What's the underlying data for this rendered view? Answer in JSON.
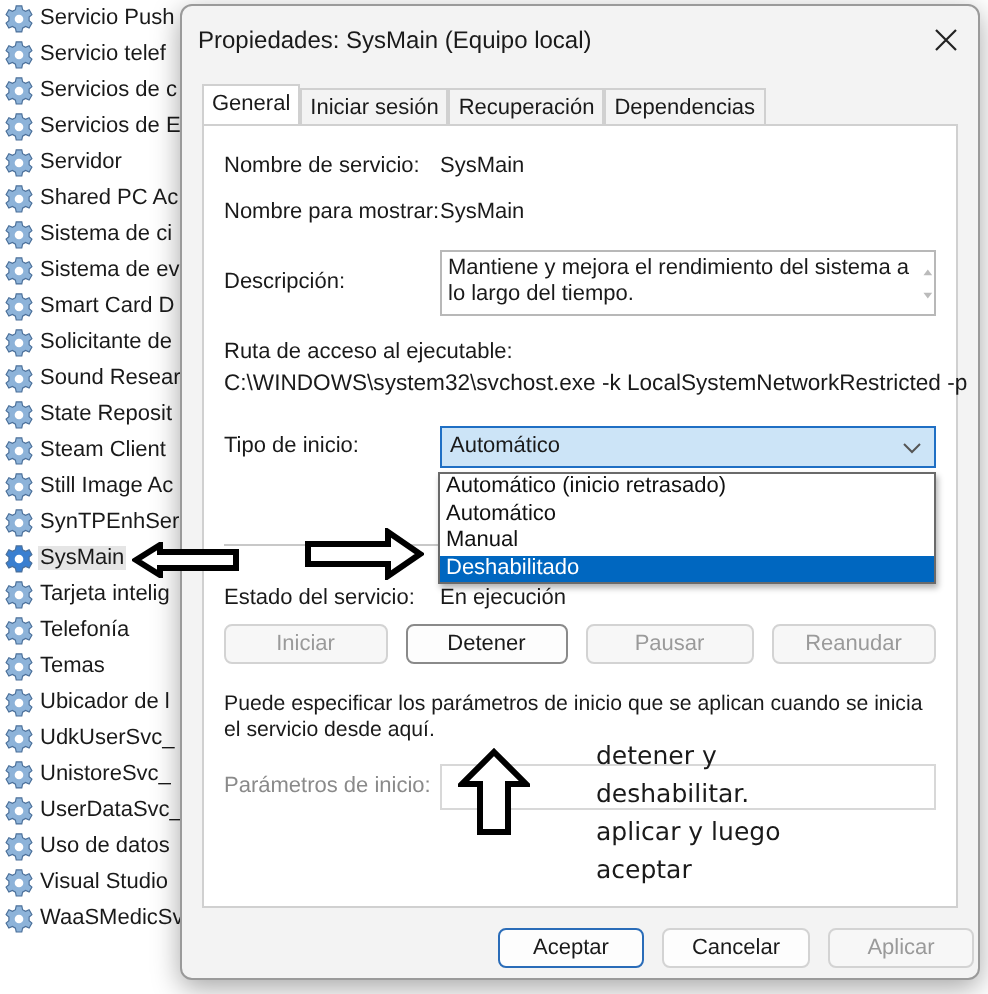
{
  "services": {
    "items": [
      {
        "name": "Servicio Push",
        "selected": false
      },
      {
        "name": "Servicio telef",
        "selected": false
      },
      {
        "name": "Servicios de c",
        "selected": false
      },
      {
        "name": "Servicios de E",
        "selected": false
      },
      {
        "name": "Servidor",
        "selected": false
      },
      {
        "name": "Shared PC Ac",
        "selected": false
      },
      {
        "name": "Sistema de ci",
        "selected": false
      },
      {
        "name": "Sistema de ev",
        "selected": false
      },
      {
        "name": "Smart Card D",
        "selected": false
      },
      {
        "name": "Solicitante de",
        "selected": false
      },
      {
        "name": "Sound Resear",
        "selected": false
      },
      {
        "name": "State Reposit",
        "selected": false
      },
      {
        "name": "Steam Client",
        "selected": false
      },
      {
        "name": "Still Image Ac",
        "selected": false
      },
      {
        "name": "SynTPEnhSer",
        "selected": false
      },
      {
        "name": "SysMain",
        "selected": true
      },
      {
        "name": "Tarjeta intelig",
        "selected": false
      },
      {
        "name": "Telefonía",
        "selected": false
      },
      {
        "name": "Temas",
        "selected": false
      },
      {
        "name": "Ubicador de l",
        "selected": false
      },
      {
        "name": "UdkUserSvc_",
        "selected": false
      },
      {
        "name": "UnistoreSvc_",
        "selected": false
      },
      {
        "name": "UserDataSvc_",
        "selected": false
      },
      {
        "name": "Uso de datos",
        "selected": false
      },
      {
        "name": "Visual Studio",
        "selected": false
      },
      {
        "name": "WaaSMedicSv",
        "selected": false
      }
    ]
  },
  "dialog": {
    "title": "Propiedades: SysMain (Equipo local)",
    "tabs": [
      {
        "label": "General",
        "selected": true
      },
      {
        "label": "Iniciar sesión",
        "selected": false
      },
      {
        "label": "Recuperación",
        "selected": false
      },
      {
        "label": "Dependencias",
        "selected": false
      }
    ],
    "service_name_label": "Nombre de servicio:",
    "service_name": "SysMain",
    "display_name_label": "Nombre para mostrar:",
    "display_name": "SysMain",
    "description_label": "Descripción:",
    "description": "Mantiene y mejora el rendimiento del sistema a lo largo del tiempo.",
    "path_label": "Ruta de acceso al ejecutable:",
    "path": "C:\\WINDOWS\\system32\\svchost.exe -k LocalSystemNetworkRestricted -p",
    "startup_type_label": "Tipo de inicio:",
    "startup_type": "Automático",
    "startup_options": [
      {
        "label": "Automático (inicio retrasado)",
        "selected": false
      },
      {
        "label": "Automático",
        "selected": false
      },
      {
        "label": "Manual",
        "selected": false
      },
      {
        "label": "Deshabilitado",
        "selected": true
      }
    ],
    "status_label": "Estado del servicio:",
    "status": "En ejecución",
    "service_buttons": [
      {
        "label": "Iniciar",
        "disabled": true,
        "focused": false
      },
      {
        "label": "Detener",
        "disabled": false,
        "focused": true
      },
      {
        "label": "Pausar",
        "disabled": true,
        "focused": false
      },
      {
        "label": "Reanudar",
        "disabled": true,
        "focused": false
      }
    ],
    "help_text": "Puede especificar los parámetros de inicio que se aplican cuando se inicia el servicio desde aquí.",
    "parameters_label": "Parámetros de inicio:",
    "buttons": [
      {
        "label": "Aceptar",
        "disabled": false,
        "default": true
      },
      {
        "label": "Cancelar",
        "disabled": false,
        "default": false
      },
      {
        "label": "Aplicar",
        "disabled": true,
        "default": false
      }
    ]
  },
  "annotation": {
    "lines": [
      "detener y",
      "deshabilitar.",
      "aplicar y luego",
      "aceptar"
    ]
  }
}
